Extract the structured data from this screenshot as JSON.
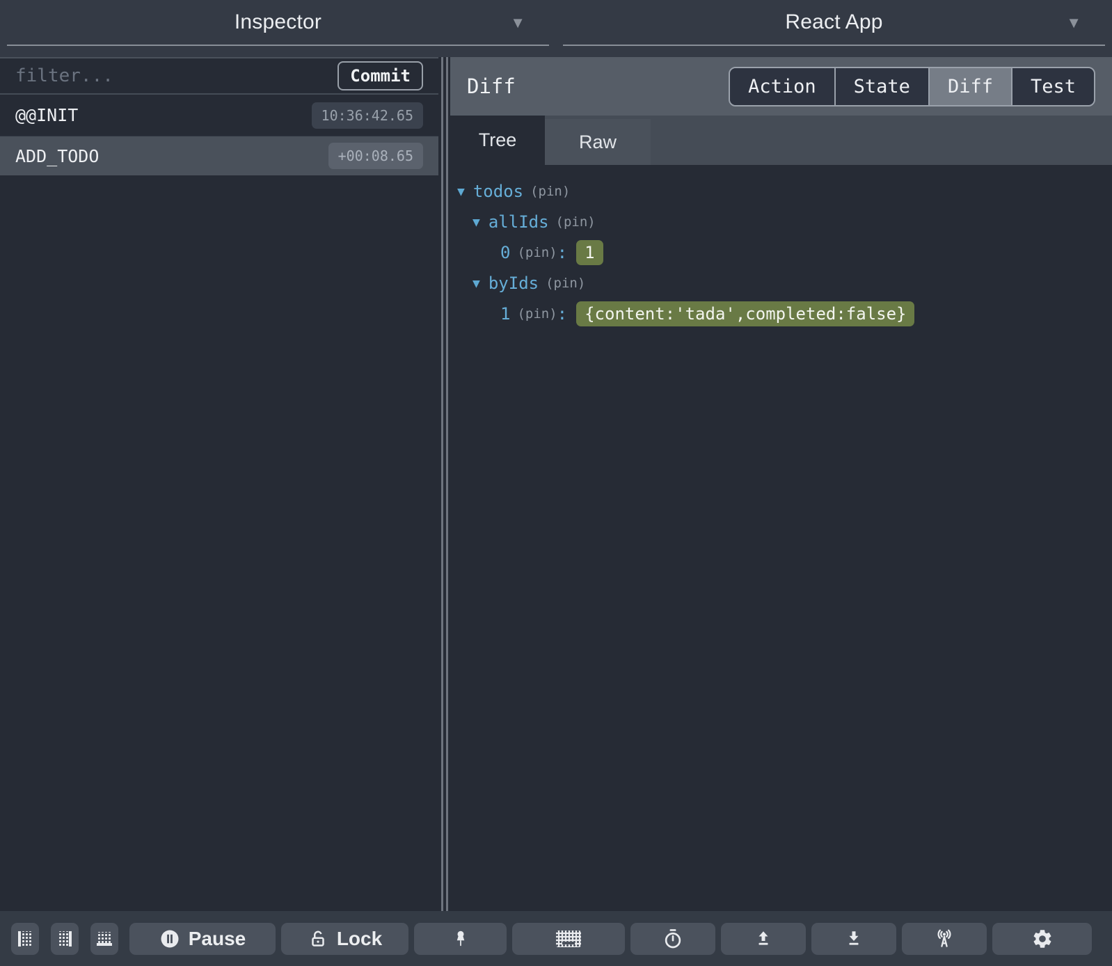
{
  "window": {
    "left_header": {
      "title": "Inspector"
    },
    "right_header": {
      "title": "React App"
    }
  },
  "icons": {
    "caret_down": "▼",
    "expander_open": "▼",
    "list": [
      "dock-left-icon",
      "dock-right-icon",
      "dock-bottom-icon",
      "pause-icon",
      "lock-icon",
      "pushpin-icon",
      "keyboard-icon",
      "stopwatch-icon",
      "upload-icon",
      "download-icon",
      "broadcast-icon",
      "gear-icon"
    ]
  },
  "inspector": {
    "filter": {
      "placeholder": "filter...",
      "value": ""
    },
    "commit_button": "Commit",
    "actions": [
      {
        "name": "@@INIT",
        "time": "10:36:42.65",
        "selected": false
      },
      {
        "name": "ADD_TODO",
        "time": "+00:08.65",
        "selected": true
      }
    ]
  },
  "preview": {
    "title": "Diff",
    "tabs": [
      {
        "label": "Action"
      },
      {
        "label": "State"
      },
      {
        "label": "Diff"
      },
      {
        "label": "Test"
      }
    ],
    "selected_tab": "Diff",
    "subtabs": [
      {
        "label": "Tree"
      },
      {
        "label": "Raw"
      }
    ],
    "selected_subtab": "Tree",
    "tree": [
      {
        "key": "todos",
        "pin": "(pin)",
        "level": 1,
        "expanded": true
      },
      {
        "key": "allIds",
        "pin": "(pin)",
        "level": 2,
        "expanded": true
      },
      {
        "key": "0",
        "pin": "(pin)",
        "colon": ":",
        "level": 3,
        "value": "1"
      },
      {
        "key": "byIds",
        "pin": "(pin)",
        "level": 2,
        "expanded": true
      },
      {
        "key": "1",
        "pin": "(pin)",
        "colon": ":",
        "level": 3,
        "value": "{content:'tada',completed:false}"
      }
    ]
  },
  "toolbar": {
    "pause_label": "Pause",
    "lock_label": "Lock"
  },
  "colors": {
    "chrome_bg": "#343a45",
    "panel_bg": "#262b35",
    "selected_gray": "#4a515b",
    "diff_header_bg": "#565d67",
    "subtab_bar_bg": "#454c56",
    "tab_selected_bg": "#767d87",
    "badge_bg": "#3b424e",
    "key_blue": "#66aed8",
    "value_green": "#697a45",
    "border_gray": "#9aa1ab"
  }
}
